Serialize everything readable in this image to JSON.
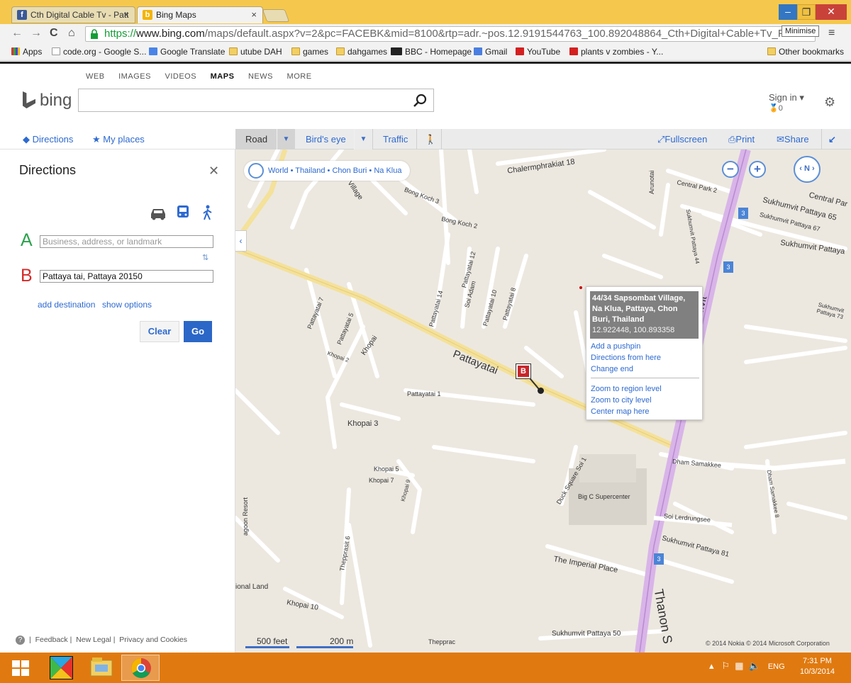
{
  "browser": {
    "tabs": [
      {
        "label": "Cth Digital Cable Tv - Patt",
        "close": "×"
      },
      {
        "label": "Bing Maps",
        "close": "×"
      }
    ],
    "url_scheme": "https://",
    "url_host": "www.bing.com",
    "url_path": "/maps/default.aspx?v=2&pc=FACEBK&mid=8100&rtp=adr.~pos.12.9191544763_100.892048864_Cth+Digital+Cable+Tv_F",
    "tooltip": "Minimise",
    "bookmarks": [
      {
        "label": "Apps",
        "icon": "apps-grid-icon"
      },
      {
        "label": "code.org - Google S...",
        "icon": "page-icon"
      },
      {
        "label": "Google Translate",
        "icon": "translate-icon"
      },
      {
        "label": "utube DAH",
        "icon": "folder-icon"
      },
      {
        "label": "games",
        "icon": "folder-icon"
      },
      {
        "label": "dahgames",
        "icon": "folder-icon"
      },
      {
        "label": "BBC - Homepage",
        "icon": "bbc-icon"
      },
      {
        "label": "Gmail",
        "icon": "gmail-icon"
      },
      {
        "label": "YouTube",
        "icon": "youtube-icon"
      },
      {
        "label": "plants v zombies - Y...",
        "icon": "youtube-icon"
      }
    ],
    "other_bookmarks": "Other bookmarks"
  },
  "bing": {
    "scopes": [
      "WEB",
      "IMAGES",
      "VIDEOS",
      "MAPS",
      "NEWS",
      "MORE"
    ],
    "logo_text": "bing",
    "signin": "Sign in",
    "points": "0"
  },
  "left_nav": {
    "directions": "Directions",
    "my_places": "My places"
  },
  "directions_panel": {
    "title": "Directions",
    "waypoint_a_letter": "A",
    "waypoint_a_placeholder": "Business, address, or landmark",
    "waypoint_b_letter": "B",
    "waypoint_b_value": "Pattaya tai, Pattaya 20150",
    "add_destination": "add destination",
    "show_options": "show options",
    "clear": "Clear",
    "go": "Go",
    "footer": {
      "feedback": "Feedback",
      "legal": "New Legal",
      "privacy": "Privacy and Cookies"
    }
  },
  "map_toolbar": {
    "road": "Road",
    "birds_eye": "Bird's eye",
    "traffic": "Traffic",
    "fullscreen": "Fullscreen",
    "print": "Print",
    "share": "Share"
  },
  "map": {
    "breadcrumb": "World • Thailand • Chon Buri • Na Klua",
    "compass": "N",
    "pin_label": "B",
    "popup": {
      "address": "44/34 Sapsombat Village, Na Klua, Pattaya, Chon Buri, Thailand",
      "coordinates": "12.922448, 100.893358",
      "links_top": [
        "Add a pushpin",
        "Directions from here",
        "Change end"
      ],
      "links_bottom": [
        "Zoom to region level",
        "Zoom to city level",
        "Center map here"
      ]
    },
    "scale_feet": "500 feet",
    "scale_m": "200 m",
    "copyright": "© 2014 Nokia   © 2014 Microsoft Corporation",
    "labels": [
      "Chalermphrakiat 18",
      "Central Park 2",
      "Central Par",
      "Sukhumvit Pattaya 65",
      "Sukhumvit Pattaya 67",
      "Sukhumvit Pattaya",
      "Sukhumvit Pattaya 44",
      "Arunotai",
      "Bong Koch 3",
      "Bong Koch 2",
      "Pattayatai",
      "Pattayatai 1",
      "Pattayatai 7",
      "Pattayatai 5",
      "Pattayatai 12",
      "Pattayatai 14",
      "Pattayatai 10",
      "Pattayatai 8",
      "Soi Adam",
      "Khopai",
      "Khopai 2",
      "Khopai 3",
      "Khopai 5",
      "Khopai 7",
      "Khopai 9",
      "Khopai 10",
      "Thanon Sukhumvit",
      "Dham Samakkee",
      "Dham Samakkee 8",
      "Duck Square Soi 1",
      "Big C Supercenter",
      "Soi Lerdrungsee",
      "Sukhumvit Pattaya 81",
      "The Imperial Place",
      "Thepprasit 6",
      "Sukhumvit Pattaya 50",
      "Sukhumvit Pattaya 73",
      "Thanon S",
      "ional Land",
      "agoon Resort",
      "Village",
      "Thepprac"
    ]
  },
  "taskbar": {
    "lang": "ENG",
    "time": "7:31 PM",
    "date": "10/3/2014"
  }
}
